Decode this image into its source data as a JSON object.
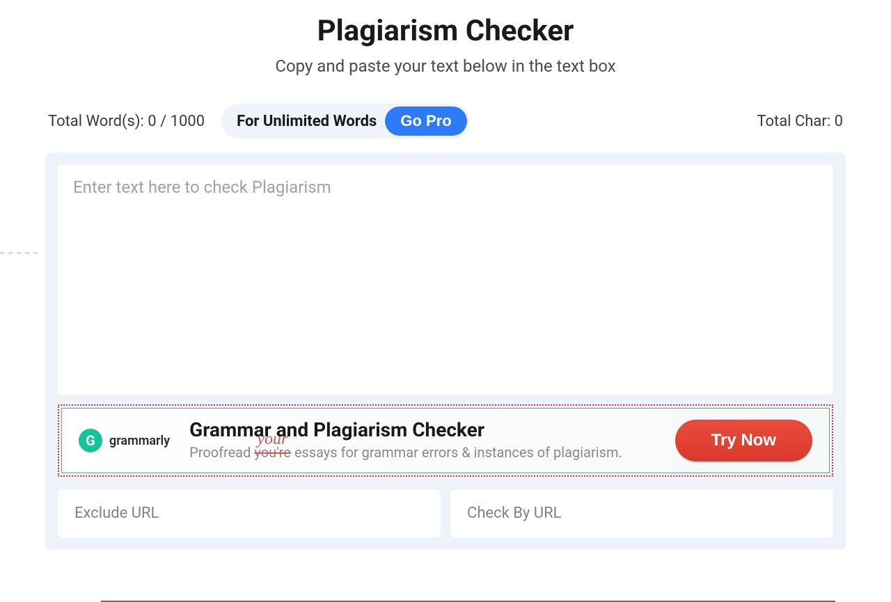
{
  "header": {
    "title": "Plagiarism Checker",
    "subtitle": "Copy and paste your text below in the text box"
  },
  "stats": {
    "word_count_label": "Total Word(s): 0 / 1000",
    "unlimited_label": "For Unlimited Words",
    "go_pro_label": "Go Pro",
    "char_count_label": "Total Char: 0"
  },
  "editor": {
    "placeholder": "Enter text here to check Plagiarism",
    "value": ""
  },
  "ad": {
    "brand": "grammarly",
    "brand_initial": "G",
    "title": "Grammar and Plagiarism Checker",
    "desc_before": "Proofread ",
    "desc_strike": "you're",
    "desc_handwriting": "your",
    "desc_after": " essays for grammar errors & instances of plagiarism.",
    "cta": "Try Now"
  },
  "url_inputs": {
    "exclude_placeholder": "Exclude URL",
    "check_placeholder": "Check By URL"
  }
}
